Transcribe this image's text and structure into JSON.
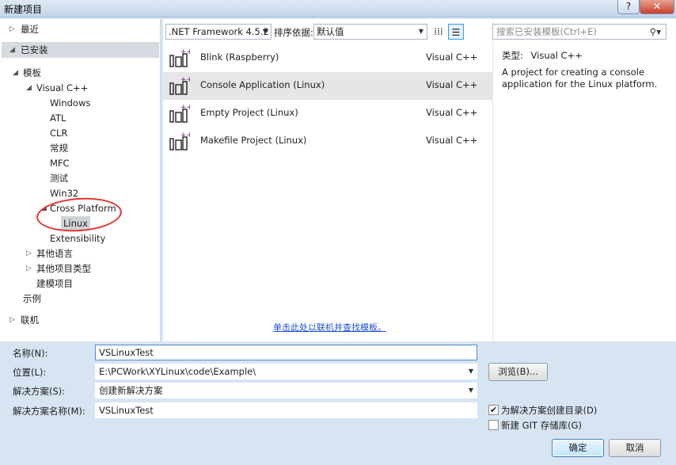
{
  "window": {
    "title": "新建项目",
    "help_label": "?",
    "close_label": "✕"
  },
  "tree": {
    "recent": "最近",
    "installed": "已安装",
    "templates": "模板",
    "visual_cpp": "Visual C++",
    "windows": "Windows",
    "atl": "ATL",
    "clr": "CLR",
    "general": "常规",
    "mfc": "MFC",
    "test": "测试",
    "win32": "Win32",
    "cross_platform": "Cross Platform",
    "linux": "Linux",
    "extensibility": "Extensibility",
    "other_languages": "其他语言",
    "other_project_types": "其他项目类型",
    "modeling_projects": "建模项目",
    "samples": "示例",
    "online": "联机"
  },
  "toolbar": {
    "framework": ".NET Framework 4.5.2",
    "sort_label": "排序依据:",
    "sort_value": "默认值"
  },
  "search": {
    "placeholder": "搜索已安装模板(Ctrl+E)"
  },
  "projects": [
    {
      "name": "Blink (Raspberry)",
      "lang": "Visual C++"
    },
    {
      "name": "Console Application (Linux)",
      "lang": "Visual C++"
    },
    {
      "name": "Empty Project (Linux)",
      "lang": "Visual C++"
    },
    {
      "name": "Makefile Project (Linux)",
      "lang": "Visual C++"
    }
  ],
  "online_link": "单击此处以联机并查找模板。",
  "description": {
    "type_label": "类型:",
    "type_value": "Visual C++",
    "text": "A project for creating a console application for the Linux platform."
  },
  "form": {
    "name_label": "名称(N):",
    "name_value": "VSLinuxTest",
    "location_label": "位置(L):",
    "location_value": "E:\\PCWork\\XYLinux\\code\\Example\\",
    "browse_label": "浏览(B)...",
    "solution_label": "解决方案(S):",
    "solution_value": "创建新解决方案",
    "solution_name_label": "解决方案名称(M):",
    "solution_name_value": "VSLinuxTest",
    "create_dir_label": "为解决方案创建目录(D)",
    "create_dir_checked": "✔",
    "git_label": "新建 GIT 存储库(G)",
    "ok_label": "确定",
    "cancel_label": "取消"
  },
  "colors": {
    "accent": "#3399ff",
    "annotation": "#e0342d",
    "link": "#1a4fd8"
  }
}
